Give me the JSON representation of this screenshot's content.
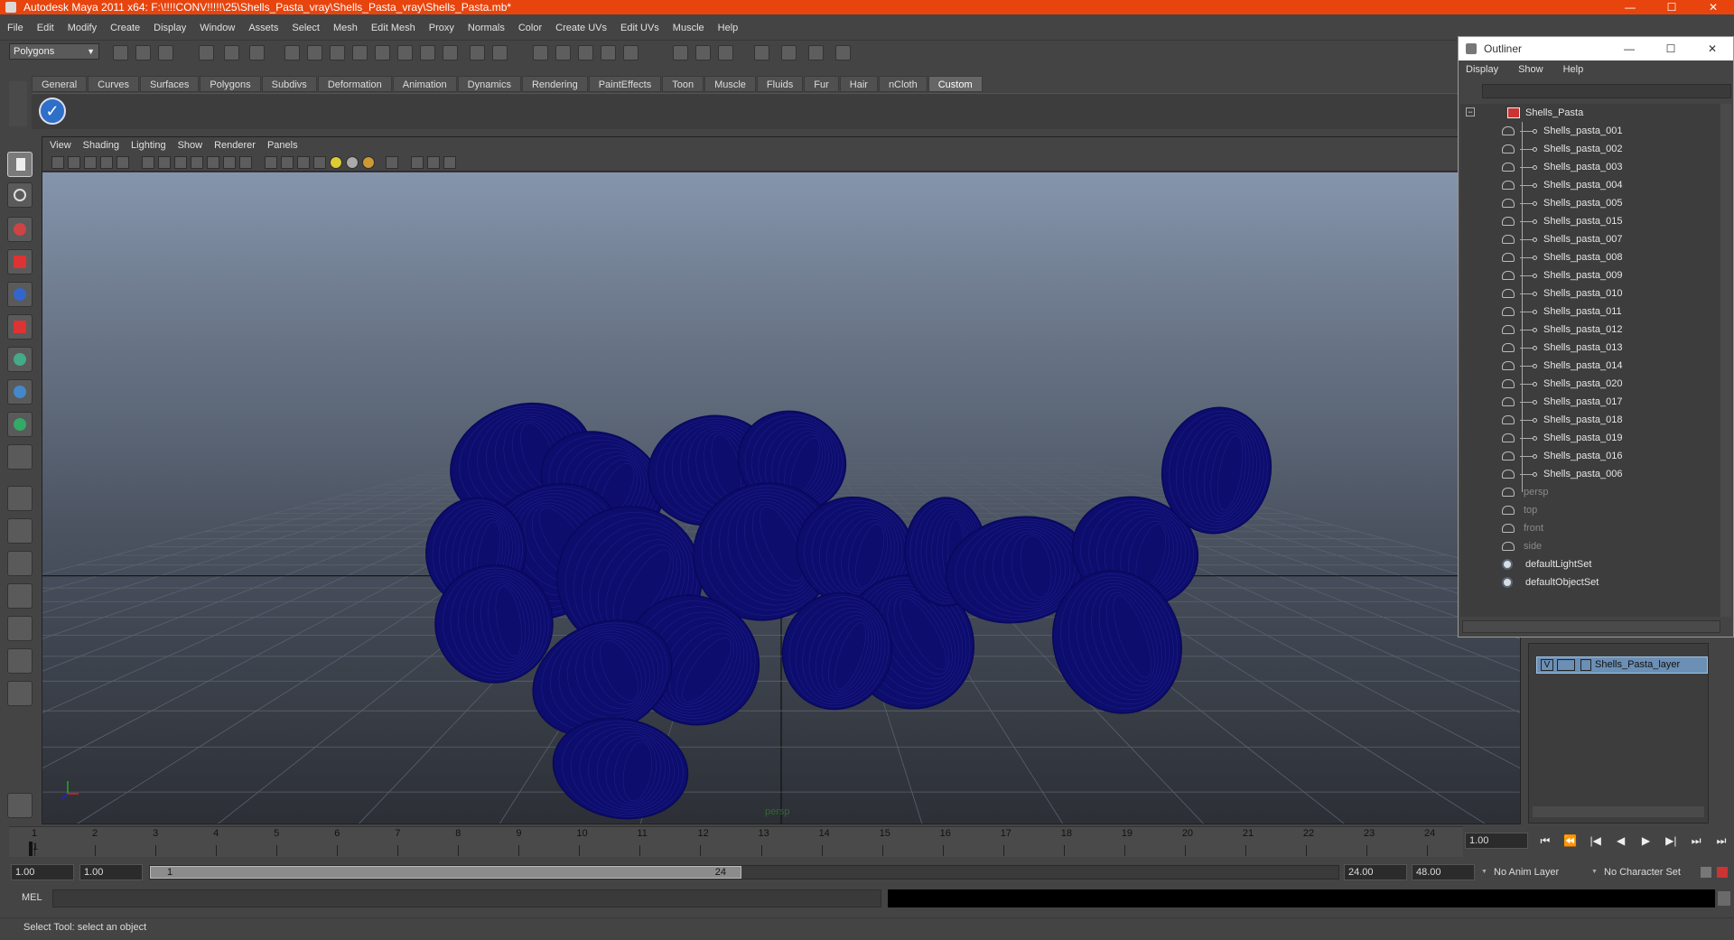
{
  "window": {
    "title": "Autodesk Maya 2011 x64: F:\\!!!!CONV!!!!!\\25\\Shells_Pasta_vray\\Shells_Pasta_vray\\Shells_Pasta.mb*",
    "controls": [
      "—",
      "☐",
      "✕"
    ]
  },
  "menubar": [
    "File",
    "Edit",
    "Modify",
    "Create",
    "Display",
    "Window",
    "Assets",
    "Select",
    "Mesh",
    "Edit Mesh",
    "Proxy",
    "Normals",
    "Color",
    "Create UVs",
    "Edit UVs",
    "Muscle",
    "Help"
  ],
  "statusline": {
    "mode": "Polygons"
  },
  "shelf": {
    "tabs": [
      "General",
      "Curves",
      "Surfaces",
      "Polygons",
      "Subdivs",
      "Deformation",
      "Animation",
      "Dynamics",
      "Rendering",
      "PaintEffects",
      "Toon",
      "Muscle",
      "Fluids",
      "Fur",
      "Hair",
      "nCloth",
      "Custom"
    ],
    "active_tab": "Custom",
    "check_glyph": "✓"
  },
  "viewport": {
    "menu": [
      "View",
      "Shading",
      "Lighting",
      "Show",
      "Renderer",
      "Panels"
    ],
    "camera_label": "persp",
    "mesh_color": "#0d0d6e"
  },
  "outliner": {
    "title": "Outliner",
    "controls": [
      "—",
      "☐",
      "✕"
    ],
    "menu": [
      "Display",
      "Show",
      "Help"
    ],
    "root": "Shells_Pasta",
    "children": [
      "Shells_pasta_001",
      "Shells_pasta_002",
      "Shells_pasta_003",
      "Shells_pasta_004",
      "Shells_pasta_005",
      "Shells_pasta_015",
      "Shells_pasta_007",
      "Shells_pasta_008",
      "Shells_pasta_009",
      "Shells_pasta_010",
      "Shells_pasta_011",
      "Shells_pasta_012",
      "Shells_pasta_013",
      "Shells_pasta_014",
      "Shells_pasta_020",
      "Shells_pasta_017",
      "Shells_pasta_018",
      "Shells_pasta_019",
      "Shells_pasta_016",
      "Shells_pasta_006"
    ],
    "cameras": [
      "persp",
      "top",
      "front",
      "side"
    ],
    "sets": [
      "defaultLightSet",
      "defaultObjectSet"
    ]
  },
  "layers": {
    "visible_flag": "V",
    "layer_name": "Shells_Pasta_layer"
  },
  "timeslider": {
    "ticks": [
      "1",
      "2",
      "3",
      "4",
      "5",
      "6",
      "7",
      "8",
      "9",
      "10",
      "11",
      "12",
      "13",
      "14",
      "15",
      "16",
      "17",
      "18",
      "19",
      "20",
      "21",
      "22",
      "23",
      "24"
    ],
    "current_frame": "1",
    "current_time_field": "1.00",
    "playback_buttons": [
      "⏮",
      "⏪",
      "|◀",
      "◀",
      "▶",
      "▶|",
      "⏭",
      "⏭"
    ]
  },
  "range": {
    "start_time": "1.00",
    "playback_start": "1.00",
    "handle_start": "1",
    "handle_end": "24",
    "playback_end": "24.00",
    "end_time": "48.00",
    "anim_layer": "No Anim Layer",
    "character_set": "No Character Set"
  },
  "cmdline": {
    "label": "MEL"
  },
  "helpline": {
    "text": "Select Tool: select an object"
  }
}
